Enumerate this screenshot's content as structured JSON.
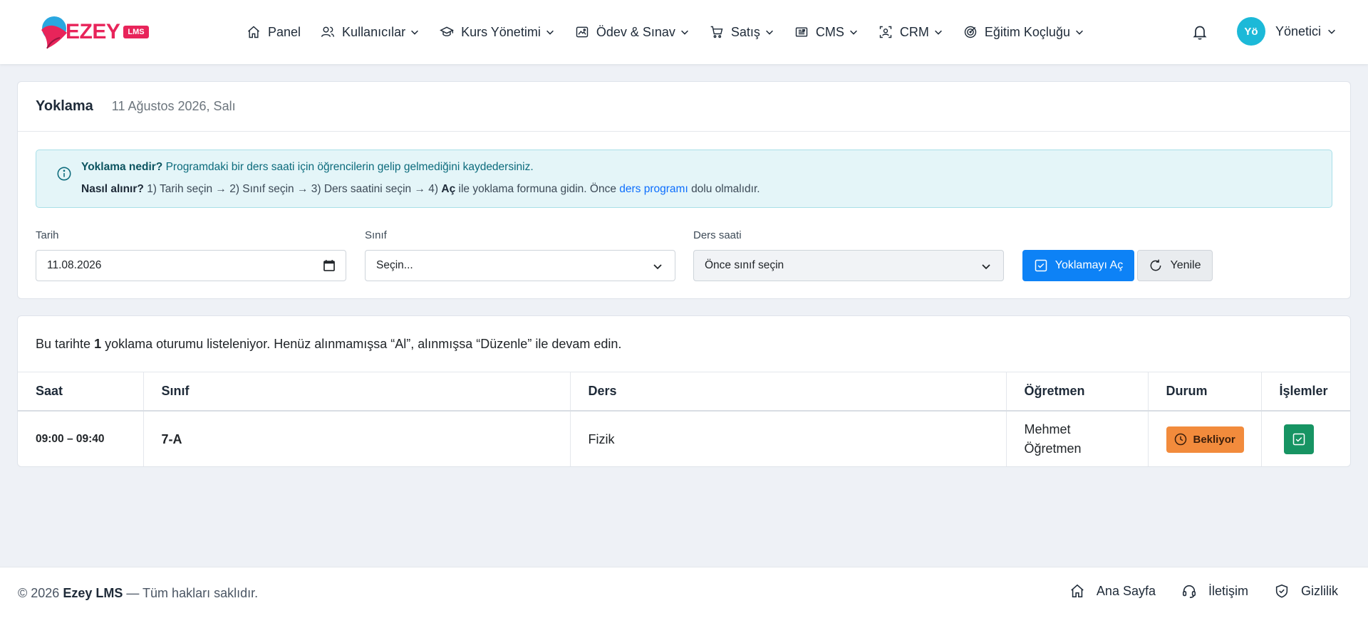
{
  "brand": {
    "name": "EZEY",
    "badge": "LMS"
  },
  "nav": {
    "items": [
      {
        "label": "Panel",
        "icon": "home-icon",
        "dropdown": false
      },
      {
        "label": "Kullanıcılar",
        "icon": "users-icon",
        "dropdown": true
      },
      {
        "label": "Kurs Yönetimi",
        "icon": "graduation-cap-icon",
        "dropdown": true
      },
      {
        "label": "Ödev & Sınav",
        "icon": "image-icon",
        "dropdown": true
      },
      {
        "label": "Satış",
        "icon": "cart-icon",
        "dropdown": true
      },
      {
        "label": "CMS",
        "icon": "newspaper-icon",
        "dropdown": true
      },
      {
        "label": "CRM",
        "icon": "scan-face-icon",
        "dropdown": true
      },
      {
        "label": "Eğitim Koçluğu",
        "icon": "target-icon",
        "dropdown": true
      }
    ],
    "user": {
      "initials": "Yö",
      "name": "Yönetici"
    }
  },
  "attendance": {
    "title": "Yoklama",
    "date_text": "11 Ağustos 2026, Salı",
    "info": {
      "q1": "Yoklama nedir?",
      "a1": "Programdaki bir ders saati için öğrencilerin gelip gelmediğini kaydedersiniz.",
      "q2": "Nasıl alınır?",
      "a2_part1": "1) Tarih seçin → 2) Sınıf seçin → 3) Ders saatini seçin → 4)",
      "a2_bold": "Aç",
      "a2_part2": "ile yoklama formuna gidin. Önce",
      "a2_link": "ders programı",
      "a2_part3": "dolu olmalıdır."
    },
    "filters": {
      "date_label": "Tarih",
      "date_value": "11.08.2026",
      "class_label": "Sınıf",
      "class_value": "Seçin...",
      "period_label": "Ders saati",
      "period_value": "Önce sınıf seçin"
    },
    "buttons": {
      "open": "Yoklamayı Aç",
      "refresh": "Yenile"
    },
    "colors": {
      "primary": "#0d82f6",
      "info_bg": "#e4f5f8",
      "pending": "#f28b3c",
      "success": "#179463",
      "brand": "#e8245a"
    }
  },
  "sessions": {
    "summary_pre": "Bu tarihte",
    "summary_count": "1",
    "summary_post": "yoklama oturumu listeleniyor. Henüz alınmamışsa “Al”, alınmışsa “Düzenle” ile devam edin.",
    "columns": [
      "Saat",
      "Sınıf",
      "Ders",
      "Öğretmen",
      "Durum",
      "İşlemler"
    ],
    "rows": [
      {
        "time": "09:00 – 09:40",
        "class": "7-A",
        "lesson": "Fizik",
        "teacher": "Mehmet Öğretmen",
        "status": "Bekliyor"
      }
    ]
  },
  "footer": {
    "year": "© 2026",
    "brand": "Ezey LMS",
    "rights": "— Tüm hakları saklıdır.",
    "links": [
      "Ana Sayfa",
      "İletişim",
      "Gizlilik"
    ]
  }
}
